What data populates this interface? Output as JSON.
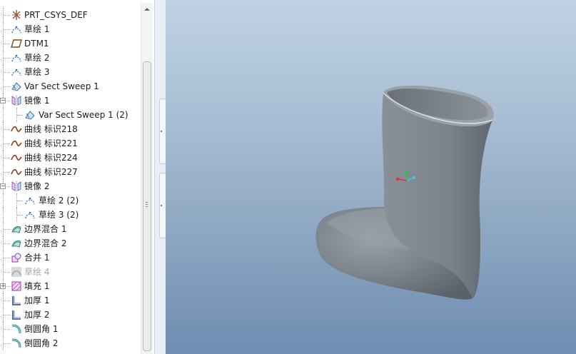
{
  "model_tree": {
    "items": [
      {
        "label": "PRT_CSYS_DEF",
        "icon": "csys-icon",
        "dim": false
      },
      {
        "label": "草绘 1",
        "icon": "sketch-icon",
        "dim": false
      },
      {
        "label": "DTM1",
        "icon": "datum-plane-icon",
        "dim": false
      },
      {
        "label": "草绘 2",
        "icon": "sketch-icon",
        "dim": false
      },
      {
        "label": "草绘 3",
        "icon": "sketch-icon",
        "dim": false
      },
      {
        "label": "Var Sect Sweep 1",
        "icon": "sweep-icon",
        "dim": false
      },
      {
        "label": "镜像 1",
        "icon": "mirror-icon",
        "dim": false,
        "expandable": true,
        "expanded": true
      },
      {
        "label": "Var Sect Sweep 1 (2)",
        "icon": "sweep-icon",
        "dim": false
      },
      {
        "label": "曲线 标识218",
        "icon": "curve-icon",
        "dim": false
      },
      {
        "label": "曲线 标识221",
        "icon": "curve-icon",
        "dim": false
      },
      {
        "label": "曲线 标识224",
        "icon": "curve-icon",
        "dim": false
      },
      {
        "label": "曲线 标识227",
        "icon": "curve-icon",
        "dim": false
      },
      {
        "label": "镜像 2",
        "icon": "mirror-icon",
        "dim": false,
        "expandable": true,
        "expanded": true
      },
      {
        "label": "草绘 2 (2)",
        "icon": "sketch-icon",
        "dim": false
      },
      {
        "label": "草绘 3 (2)",
        "icon": "sketch-icon",
        "dim": false
      },
      {
        "label": "边界混合 1",
        "icon": "boundary-blend-icon",
        "dim": false
      },
      {
        "label": "边界混合 2",
        "icon": "boundary-blend-icon",
        "dim": false
      },
      {
        "label": "合并 1",
        "icon": "merge-icon",
        "dim": false
      },
      {
        "label": "草绘 4",
        "icon": "sketch-hidden-icon",
        "dim": true
      },
      {
        "label": "填充 1",
        "icon": "fill-icon",
        "dim": false,
        "expandable": true,
        "expanded": false
      },
      {
        "label": "加厚 1",
        "icon": "thicken-icon",
        "dim": false
      },
      {
        "label": "加厚 2",
        "icon": "thicken-icon",
        "dim": false
      },
      {
        "label": "倒圆角 1",
        "icon": "round-icon",
        "dim": false
      },
      {
        "label": "倒圆角 2",
        "icon": "round-icon",
        "dim": false
      }
    ]
  },
  "colors": {
    "viewport_top": "#c0d2e4",
    "viewport_bottom": "#6e8db1",
    "model_surface": "#7d858d",
    "csys_x": "#e03030",
    "csys_y": "#30c040",
    "csys_z": "#40c8d8"
  },
  "viewport": {
    "content": "shaded-3d-model",
    "csys_marker": "csys-triad-icon"
  }
}
